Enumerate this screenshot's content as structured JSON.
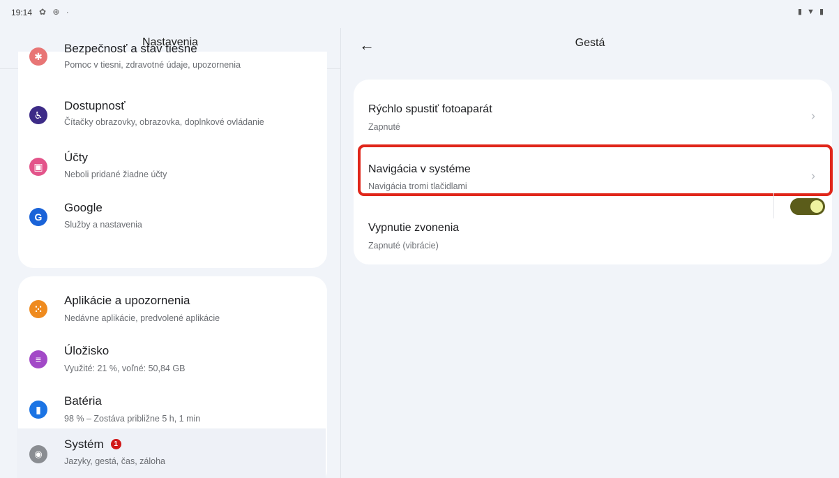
{
  "status": {
    "time": "19:14",
    "left_icons": "✿ ⊕ ·",
    "right_icons": "▮ ▼ ▮"
  },
  "left": {
    "header": "Nastavenia",
    "partial_item": {
      "title": "Bezpečnosť a stav tiesne",
      "subtitle": "Pomoc v tiesni, zdravotné údaje, upozornenia",
      "icon": "asterisk-icon",
      "color": "#e87575"
    },
    "group1": [
      {
        "title": "Dostupnosť",
        "subtitle": "Čítačky obrazovky, obrazovka, doplnkové ovládanie",
        "icon": "accessibility-icon",
        "glyph": "♿",
        "color": "#3d2b87"
      },
      {
        "title": "Účty",
        "subtitle": "Neboli pridané žiadne účty",
        "icon": "account-icon",
        "glyph": "▣",
        "color": "#e3548a"
      },
      {
        "title": "Google",
        "subtitle": "Služby a nastavenia",
        "icon": "google-icon",
        "glyph": "G",
        "color": "#1a63d8"
      }
    ],
    "group2": [
      {
        "title": "Aplikácie a upozornenia",
        "subtitle": "Nedávne aplikácie, predvolené aplikácie",
        "icon": "apps-icon",
        "glyph": "⁙",
        "color": "#ef8b1f"
      },
      {
        "title": "Úložisko",
        "subtitle": "Využité: 21 %, voľné: 50,84 GB",
        "icon": "storage-icon",
        "glyph": "≡",
        "color": "#a249c7"
      },
      {
        "title": "Batéria",
        "subtitle": "98 % – Zostáva približne 5 h, 1 min",
        "icon": "battery-icon",
        "glyph": "▮",
        "color": "#1b74e4"
      },
      {
        "title": "Systém",
        "subtitle": "Jazyky, gestá, čas, záloha",
        "icon": "system-icon",
        "glyph": "◉",
        "color": "#8a8d92",
        "badge": "1"
      }
    ]
  },
  "right": {
    "header": "Gestá",
    "back_icon": "←",
    "items": [
      {
        "title": "Rýchlo spustiť fotoaparát",
        "subtitle": "Zapnuté",
        "chevron": "›"
      },
      {
        "title": "Navigácia v systéme",
        "subtitle": "Navigácia tromi tlačidlami",
        "chevron": "›"
      },
      {
        "title": "Vypnutie zvonenia",
        "subtitle": "Zapnuté (vibrácie)",
        "toggle_on": true
      }
    ],
    "highlight_color": "#e0261a"
  }
}
